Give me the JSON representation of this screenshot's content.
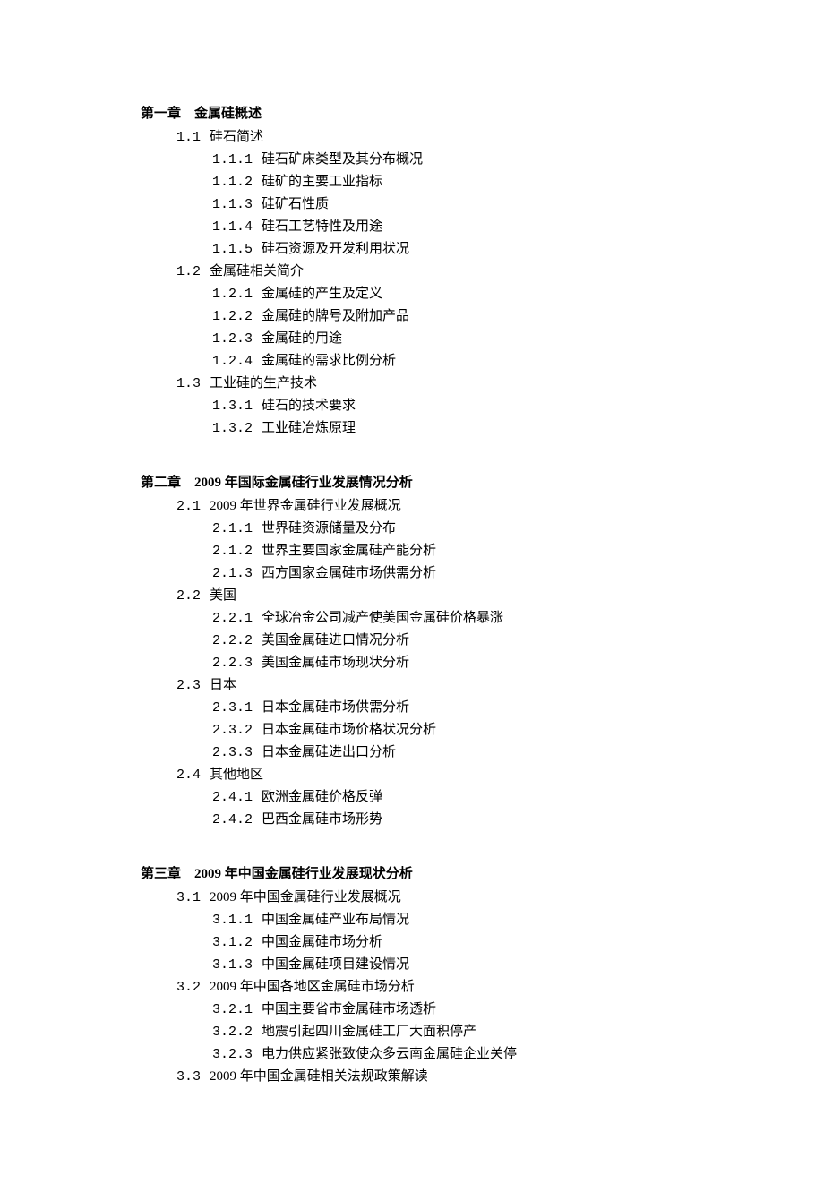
{
  "chapters": [
    {
      "title": "第一章　金属硅概述",
      "sections": [
        {
          "num": "1.1",
          "title": "硅石简述",
          "subs": [
            {
              "num": "1.1.1",
              "title": "硅石矿床类型及其分布概况"
            },
            {
              "num": "1.1.2",
              "title": "硅矿的主要工业指标"
            },
            {
              "num": "1.1.3",
              "title": "硅矿石性质"
            },
            {
              "num": "1.1.4",
              "title": "硅石工艺特性及用途"
            },
            {
              "num": "1.1.5",
              "title": "硅石资源及开发利用状况"
            }
          ]
        },
        {
          "num": "1.2",
          "title": "金属硅相关简介",
          "subs": [
            {
              "num": "1.2.1",
              "title": "金属硅的产生及定义"
            },
            {
              "num": "1.2.2",
              "title": "金属硅的牌号及附加产品"
            },
            {
              "num": "1.2.3",
              "title": "金属硅的用途"
            },
            {
              "num": "1.2.4",
              "title": "金属硅的需求比例分析"
            }
          ]
        },
        {
          "num": "1.3",
          "title": "工业硅的生产技术",
          "subs": [
            {
              "num": "1.3.1",
              "title": "硅石的技术要求"
            },
            {
              "num": "1.3.2",
              "title": "工业硅冶炼原理"
            }
          ]
        }
      ]
    },
    {
      "title": "第二章　2009 年国际金属硅行业发展情况分析",
      "sections": [
        {
          "num": "2.1",
          "title": "2009 年世界金属硅行业发展概况",
          "subs": [
            {
              "num": "2.1.1",
              "title": "世界硅资源储量及分布"
            },
            {
              "num": "2.1.2",
              "title": "世界主要国家金属硅产能分析"
            },
            {
              "num": "2.1.3",
              "title": "西方国家金属硅市场供需分析"
            }
          ]
        },
        {
          "num": "2.2",
          "title": "美国",
          "subs": [
            {
              "num": "2.2.1",
              "title": "全球冶金公司减产使美国金属硅价格暴涨"
            },
            {
              "num": "2.2.2",
              "title": "美国金属硅进口情况分析"
            },
            {
              "num": "2.2.3",
              "title": "美国金属硅市场现状分析"
            }
          ]
        },
        {
          "num": "2.3",
          "title": "日本",
          "subs": [
            {
              "num": "2.3.1",
              "title": "日本金属硅市场供需分析"
            },
            {
              "num": "2.3.2",
              "title": "日本金属硅市场价格状况分析"
            },
            {
              "num": "2.3.3",
              "title": "日本金属硅进出口分析"
            }
          ]
        },
        {
          "num": "2.4",
          "title": "其他地区",
          "subs": [
            {
              "num": "2.4.1",
              "title": "欧洲金属硅价格反弹"
            },
            {
              "num": "2.4.2",
              "title": "巴西金属硅市场形势"
            }
          ]
        }
      ]
    },
    {
      "title": "第三章　2009 年中国金属硅行业发展现状分析",
      "sections": [
        {
          "num": "3.1",
          "title": "2009 年中国金属硅行业发展概况",
          "subs": [
            {
              "num": "3.1.1",
              "title": "中国金属硅产业布局情况"
            },
            {
              "num": "3.1.2",
              "title": "中国金属硅市场分析"
            },
            {
              "num": "3.1.3",
              "title": "中国金属硅项目建设情况"
            }
          ]
        },
        {
          "num": "3.2",
          "title": "2009 年中国各地区金属硅市场分析",
          "subs": [
            {
              "num": "3.2.1",
              "title": "中国主要省市金属硅市场透析"
            },
            {
              "num": "3.2.2",
              "title": "地震引起四川金属硅工厂大面积停产"
            },
            {
              "num": "3.2.3",
              "title": "电力供应紧张致使众多云南金属硅企业关停"
            }
          ]
        },
        {
          "num": "3.3",
          "title": "2009 年中国金属硅相关法规政策解读",
          "subs": []
        }
      ]
    }
  ]
}
